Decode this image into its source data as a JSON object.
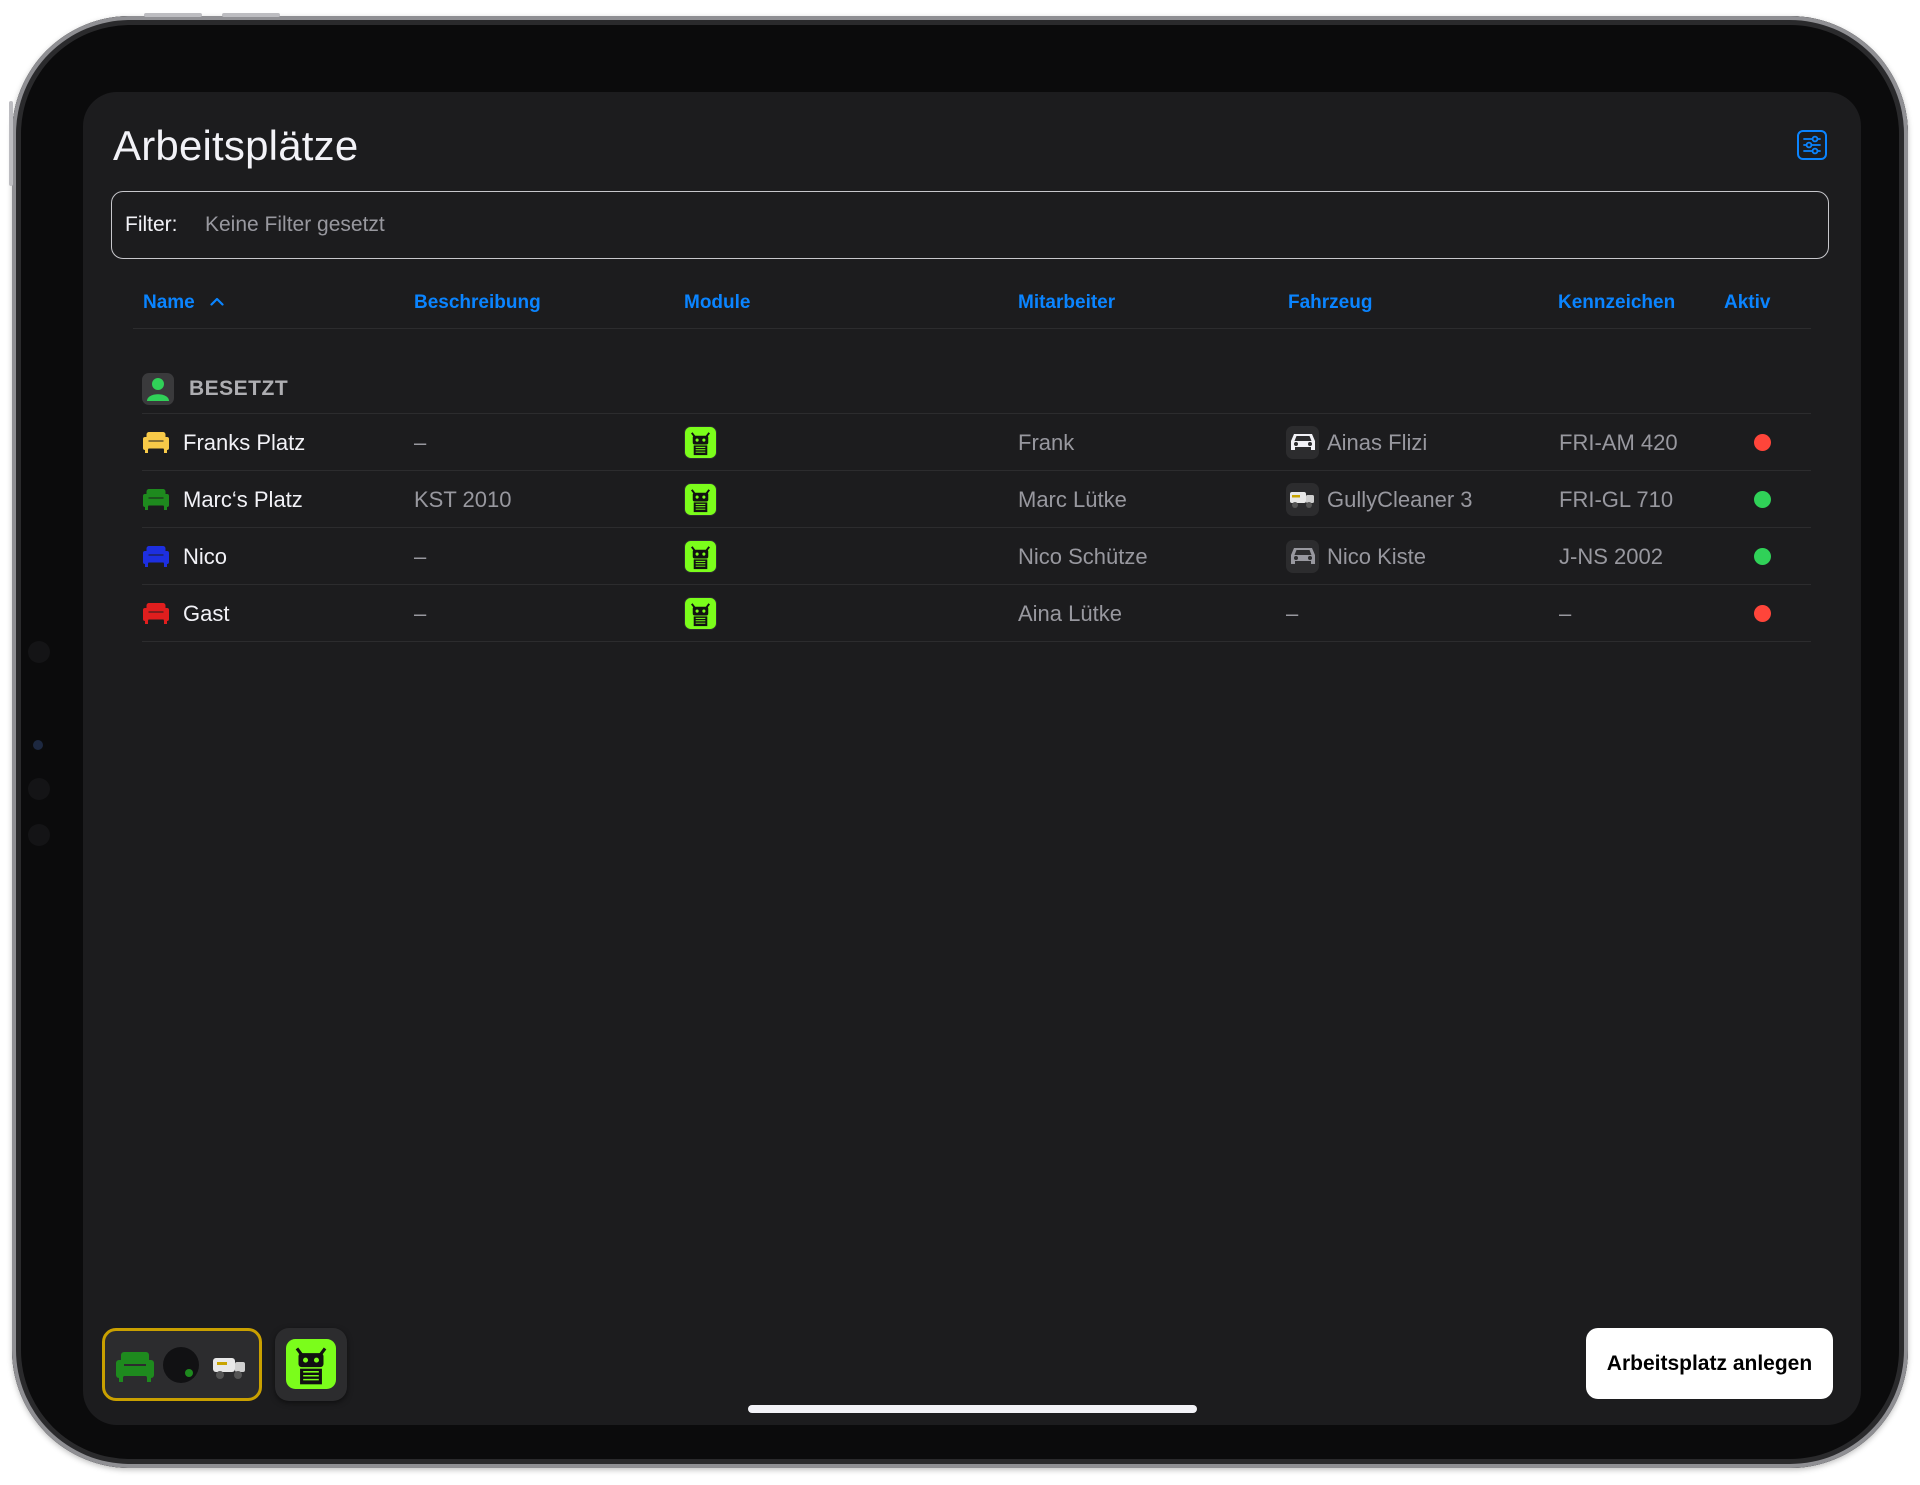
{
  "app": {
    "title": "Arbeitsplätze"
  },
  "filter": {
    "label": "Filter:",
    "placeholder": "Keine Filter gesetzt",
    "value": ""
  },
  "table": {
    "columns": {
      "name": "Name",
      "description": "Beschreibung",
      "modules": "Module",
      "employee": "Mitarbeiter",
      "vehicle": "Fahrzeug",
      "plate": "Kennzeichen",
      "active": "Aktiv"
    },
    "sort": {
      "column": "name",
      "direction": "ascending"
    },
    "section": {
      "label": "BESETZT",
      "icon": "person-icon",
      "icon_color": "#30d158"
    },
    "rows": [
      {
        "name": "Franks Platz",
        "seat_color": "#f7c948",
        "description": "–",
        "module_icon": "robot-module-icon",
        "employee": "Frank",
        "vehicle_icon": "car-icon",
        "vehicle": "Ainas Flizi",
        "plate": "FRI-AM 420",
        "active": false
      },
      {
        "name": "Marc‘s Platz",
        "seat_color": "#1e8a1e",
        "description": "KST 2010",
        "module_icon": "robot-module-icon",
        "employee": "Marc Lütke",
        "vehicle_icon": "truck-icon",
        "vehicle": "GullyCleaner 3",
        "plate": "FRI-GL 710",
        "active": true
      },
      {
        "name": "Nico",
        "seat_color": "#1d2fe0",
        "description": "–",
        "module_icon": "robot-module-icon",
        "employee": "Nico Schütze",
        "vehicle_icon": "car-icon",
        "vehicle": "Nico Kiste",
        "plate": "J-NS 2002",
        "active": true
      },
      {
        "name": "Gast",
        "seat_color": "#e01e1e",
        "description": "–",
        "module_icon": "robot-module-icon",
        "employee": "Aina Lütke",
        "vehicle_icon": "",
        "vehicle": "–",
        "plate": "–",
        "active": false
      }
    ]
  },
  "colors": {
    "accent": "#0a84ff",
    "background": "#1c1c1e",
    "active_on": "#30d158",
    "active_off": "#ff453a",
    "module_green": "#7bfd1b",
    "chip_border": "#c9a000"
  },
  "footer": {
    "workspace_chip": {
      "seat_color": "#1e8a1e",
      "icons": [
        "armchair-icon",
        "status-dot-icon",
        "truck-icon"
      ]
    },
    "module_chip": {
      "icon": "robot-module-icon"
    },
    "create_button": "Arbeitsplatz anlegen"
  }
}
